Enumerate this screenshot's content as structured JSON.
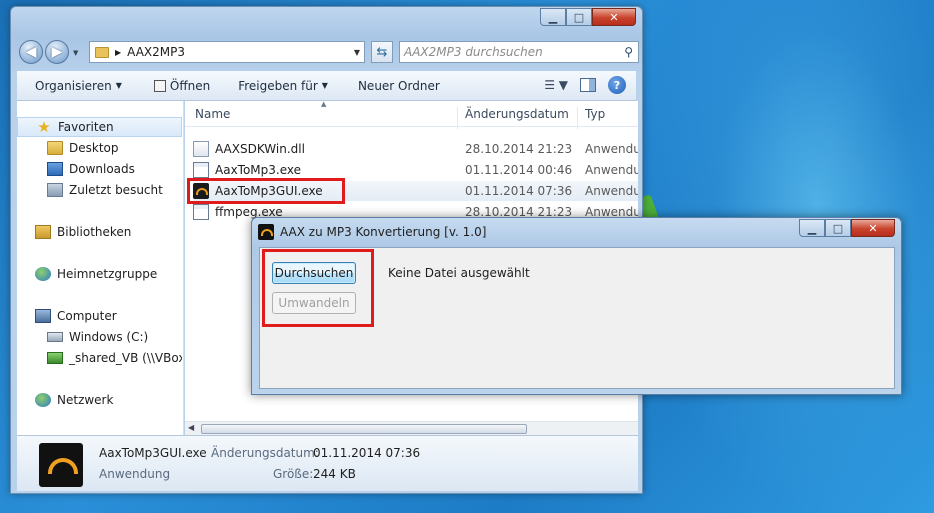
{
  "explorer": {
    "address": "AAX2MP3",
    "search_placeholder": "AAX2MP3 durchsuchen",
    "toolbar": {
      "organize": "Organisieren",
      "open": "Öffnen",
      "share": "Freigeben für",
      "new_folder": "Neuer Ordner"
    },
    "nav": {
      "favorites": "Favoriten",
      "desktop": "Desktop",
      "downloads": "Downloads",
      "recent": "Zuletzt besucht",
      "libraries": "Bibliotheken",
      "homegroup": "Heimnetzgruppe",
      "computer": "Computer",
      "drive_c": "Windows (C:)",
      "shared": "_shared_VB (\\\\VBoxSvr)",
      "network": "Netzwerk"
    },
    "columns": {
      "name": "Name",
      "date": "Änderungsdatum",
      "type": "Typ"
    },
    "files": [
      {
        "name": "AAXSDKWin.dll",
        "date": "28.10.2014 21:23",
        "type": "Anwendungserweiterung",
        "icon": "dll-icon"
      },
      {
        "name": "AaxToMp3.exe",
        "date": "01.11.2014 00:46",
        "type": "Anwendung",
        "icon": "exe-icon"
      },
      {
        "name": "AaxToMp3GUI.exe",
        "date": "01.11.2014 07:36",
        "type": "Anwendung",
        "icon": "app-icon"
      },
      {
        "name": "ffmpeg.exe",
        "date": "28.10.2014 21:23",
        "type": "Anwendung",
        "icon": "exe-icon"
      }
    ],
    "details": {
      "name": "AaxToMp3GUI.exe",
      "kind": "Anwendung",
      "modified_label": "Änderungsdatum:",
      "modified_value": "01.11.2014 07:36",
      "size_label": "Größe:",
      "size_value": "244 KB"
    }
  },
  "dialog": {
    "title": "AAX zu MP3 Konvertierung [v. 1.0]",
    "browse_button": "Durchsuchen",
    "convert_button": "Umwandeln",
    "status": "Keine Datei ausgewählt"
  },
  "colors": {
    "highlight": "#e01b1b",
    "desktop": "#2a8fd8"
  }
}
